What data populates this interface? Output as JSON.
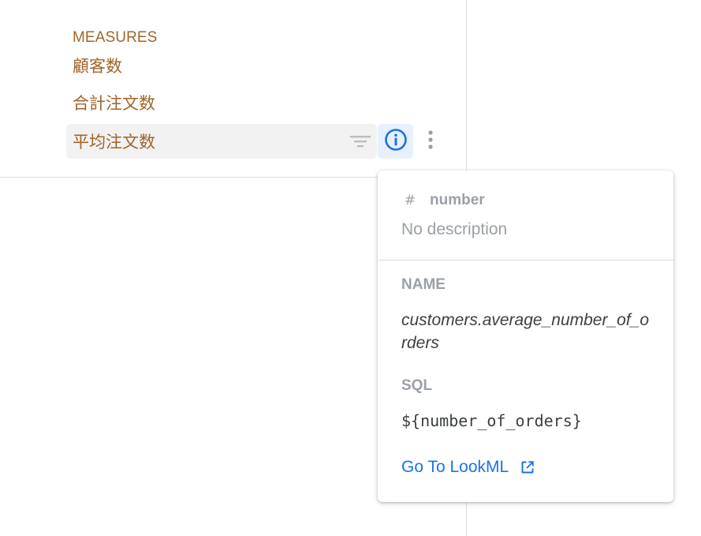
{
  "measures": {
    "section_label": "MEASURES",
    "fields": [
      {
        "label": "顧客数"
      },
      {
        "label": "合計注文数"
      },
      {
        "label": "平均注文数",
        "selected": true
      }
    ]
  },
  "icons": {
    "filter": "filter-icon",
    "info": "info-icon",
    "more": "more-vert-icon",
    "type": "hash-icon",
    "external": "external-link-icon"
  },
  "popover": {
    "type_symbol": "#",
    "type": "number",
    "description": "No description",
    "name_label": "NAME",
    "name_value": "customers.average_number_of_orders",
    "sql_label": "SQL",
    "sql_value": "${number_of_orders}",
    "link_label": "Go To LookML"
  },
  "colors": {
    "measure_text": "#a0642a",
    "link": "#1a73e8",
    "info_active_bg": "#e8f0fe",
    "muted": "#9aa0a6"
  }
}
